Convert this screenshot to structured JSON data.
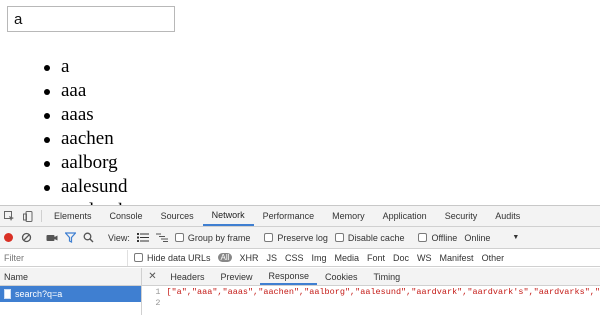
{
  "search": {
    "value": "a"
  },
  "results": [
    "a",
    "aaa",
    "aaas",
    "aachen",
    "aalborg",
    "aalesund",
    "aardvark"
  ],
  "devtools": {
    "tabs": [
      "Elements",
      "Console",
      "Sources",
      "Network",
      "Performance",
      "Memory",
      "Application",
      "Security",
      "Audits"
    ],
    "active_tab": "Network",
    "toolbar": {
      "view_label": "View:",
      "group_by_frame": "Group by frame",
      "preserve_log": "Preserve log",
      "disable_cache": "Disable cache",
      "offline": "Offline",
      "throttle": "Online"
    },
    "filter": {
      "placeholder": "Filter",
      "hide_data_urls": "Hide data URLs",
      "types": [
        "All",
        "XHR",
        "JS",
        "CSS",
        "Img",
        "Media",
        "Font",
        "Doc",
        "WS",
        "Manifest",
        "Other"
      ]
    },
    "name_header": "Name",
    "requests": [
      "search?q=a"
    ],
    "detail_tabs": [
      "Headers",
      "Preview",
      "Response",
      "Cookies",
      "Timing"
    ],
    "active_detail_tab": "Response",
    "response": {
      "lines": [
        {
          "num": "1",
          "text": "[\"a\",\"aaa\",\"aaas\",\"aachen\",\"aalborg\",\"aalesund\",\"aardvark\",\"aardvark's\",\"aardvarks\",\""
        },
        {
          "num": "2",
          "text": ""
        }
      ]
    },
    "colors": {
      "accent": "#3f7fd1",
      "record": "#d93025",
      "filter_icon": "#3f7fd1"
    }
  }
}
